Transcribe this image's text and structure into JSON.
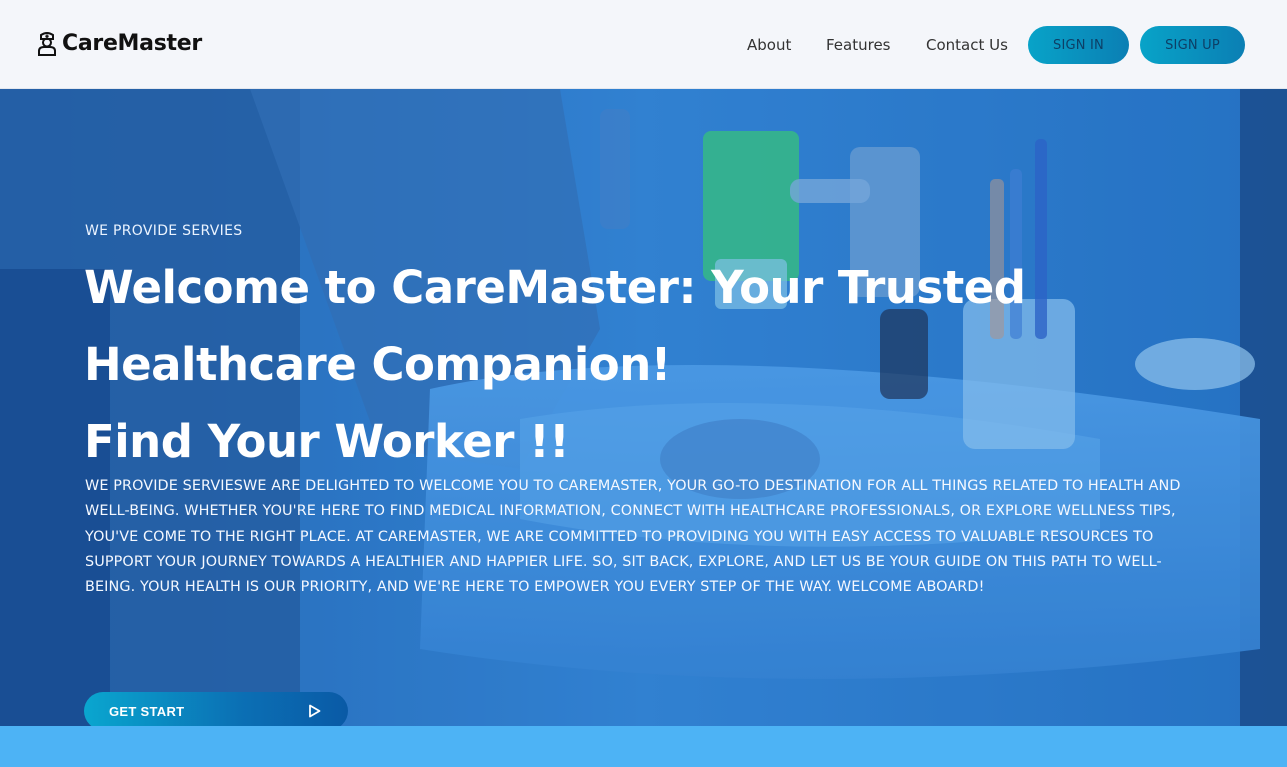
{
  "brand": {
    "name": "CareMaster",
    "icon": "nurse-icon"
  },
  "nav": {
    "links": [
      "About",
      "Features",
      "Contact Us"
    ],
    "sign_in": "SIGN IN",
    "sign_up": "SIGN UP"
  },
  "hero": {
    "eyebrow": "WE PROVIDE SERVIES",
    "headline_lines": [
      "Welcome to CareMaster: Your Trusted",
      "Healthcare Companion!",
      "Find Your Worker !!"
    ],
    "body": "WE PROVIDE SERVIESWE ARE DELIGHTED TO WELCOME YOU TO CAREMASTER, YOUR GO-TO DESTINATION FOR ALL THINGS RELATED TO HEALTH AND WELL-BEING. WHETHER YOU'RE HERE TO FIND MEDICAL INFORMATION, CONNECT WITH HEALTHCARE PROFESSIONALS, OR EXPLORE WELLNESS TIPS, YOU'VE COME TO THE RIGHT PLACE. AT CAREMASTER, WE ARE COMMITTED TO PROVIDING YOU WITH EASY ACCESS TO VALUABLE RESOURCES TO SUPPORT YOUR JOURNEY TOWARDS A HEALTHIER AND HAPPIER LIFE. SO, SIT BACK, EXPLORE, AND LET US BE YOUR GUIDE ON THIS PATH TO WELL-BEING. YOUR HEALTH IS OUR PRIORITY, AND WE'RE HERE TO EMPOWER YOU EVERY STEP OF THE WAY. WELCOME ABOARD!",
    "cta_label": "GET START",
    "cta_icon": "play-icon",
    "background_image": "bathroom-sink-photo"
  },
  "colors": {
    "nav_bg": "#f4f6fa",
    "button_gradient_start": "#08a3c8",
    "button_gradient_end": "#0b7fb4",
    "hero_tint": "#1e6fb8",
    "bottom_strip": "#4db3f5"
  }
}
